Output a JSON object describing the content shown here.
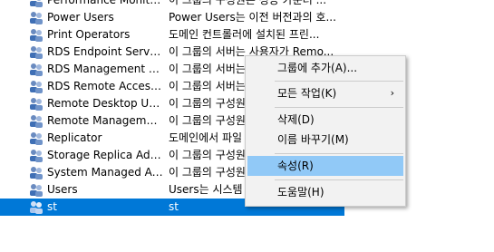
{
  "groups": [
    {
      "name": "Performance Monitor...",
      "desc": "이 그룹의 구성원은 성능 카운터 ..."
    },
    {
      "name": "Power Users",
      "desc": "Power Users는 이전 버전과의 호..."
    },
    {
      "name": "Print Operators",
      "desc": "도메인 컨트롤러에 설치된 프린..."
    },
    {
      "name": "RDS Endpoint Servers",
      "desc": "이 그룹의 서버는 사용자가 Remo..."
    },
    {
      "name": "RDS Management Se...",
      "desc": "이 그룹의 서버는"
    },
    {
      "name": "RDS Remote Access ...",
      "desc": "이 그룹의 서버는"
    },
    {
      "name": "Remote Desktop Users",
      "desc": "이 그룹의 구성원"
    },
    {
      "name": "Remote Management...",
      "desc": "이 그룹의 구성원"
    },
    {
      "name": "Replicator",
      "desc": "도메인에서 파일"
    },
    {
      "name": "Storage Replica Admi...",
      "desc": "이 그룹의 구성원"
    },
    {
      "name": "System Managed Acc...",
      "desc": "이 그룹의 구성원"
    },
    {
      "name": "Users",
      "desc": "Users는 시스템"
    },
    {
      "name": "st",
      "desc": "st"
    }
  ],
  "selected_index": 12,
  "context_menu": {
    "add_to_group": "그룹에 추가(A)...",
    "all_tasks": "모든 작업(K)",
    "submenu_arrow": "›",
    "delete": "삭제(D)",
    "rename": "이름 바꾸기(M)",
    "properties": "속성(R)",
    "help": "도움말(H)"
  },
  "colors": {
    "selection": "#0078d7",
    "menu_highlight": "#91c9f7",
    "menu_bg": "#f2f2f2"
  }
}
